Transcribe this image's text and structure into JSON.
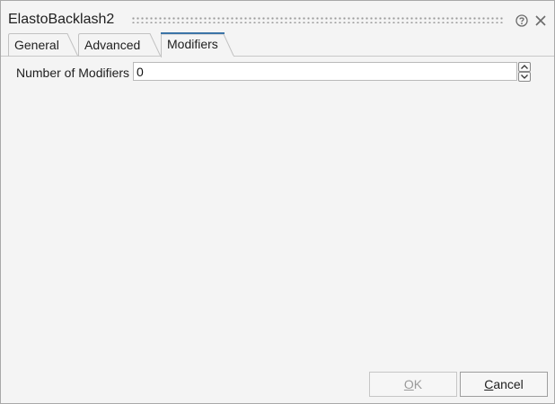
{
  "window": {
    "title": "ElastoBacklash2",
    "help_icon": "help-circle-icon",
    "close_icon": "close-icon"
  },
  "tabs": [
    {
      "label": "General",
      "active": false
    },
    {
      "label": "Advanced",
      "active": false
    },
    {
      "label": "Modifiers",
      "active": true
    }
  ],
  "modifiers": {
    "count_label": "Number of Modifiers",
    "count_value": "0"
  },
  "buttons": {
    "ok": {
      "accel": "O",
      "rest": "K",
      "enabled": false
    },
    "cancel": {
      "accel": "C",
      "rest": "ancel",
      "enabled": true
    }
  },
  "colors": {
    "active_tab_accent": "#3b74a6",
    "background": "#f4f4f4"
  }
}
